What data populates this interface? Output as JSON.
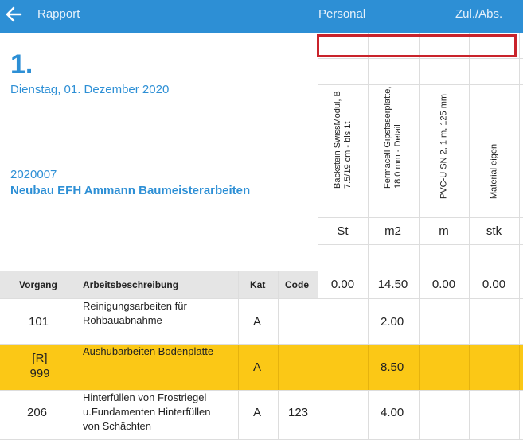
{
  "topbar": {
    "back_label": "Rapport",
    "personal_label": "Personal",
    "zul_label": "Zul./Abs."
  },
  "day": {
    "number": "1.",
    "date": "Dienstag, 01. Dezember 2020"
  },
  "project": {
    "number": "2020007",
    "name": "Neubau EFH Ammann Baumeisterarbeiten"
  },
  "materials": [
    {
      "name": "Backstein SwissModul, B 7.5/19 cm - bis 1t",
      "unit": "St",
      "total": "0.00"
    },
    {
      "name": "Fermacell Gipsfaserplatte, 18.0 mm - Detail",
      "unit": "m2",
      "total": "14.50"
    },
    {
      "name": "PVC-U SN 2, 1 m, 125 mm",
      "unit": "m",
      "total": "0.00"
    },
    {
      "name": "Material eigen",
      "unit": "stk",
      "total": "0.00"
    }
  ],
  "table": {
    "headers": {
      "vorgang": "Vorgang",
      "beschreibung": "Arbeitsbeschreibung",
      "kat": "Kat",
      "code": "Code"
    },
    "rows": [
      {
        "vorgang": "101",
        "beschreibung": "Reinigungsarbeiten für Rohbauabnahme",
        "kat": "A",
        "code": "",
        "qty": "2.00",
        "highlight": false
      },
      {
        "vorgang": "[R]\n999",
        "beschreibung": "Aushubarbeiten Bodenplatte",
        "kat": "A",
        "code": "",
        "qty": "8.50",
        "highlight": true
      },
      {
        "vorgang": "206",
        "beschreibung": "Hinterfüllen von Frostriegel u.Fundamenten Hinterfüllen von Schächten",
        "kat": "A",
        "code": "123",
        "qty": "4.00",
        "highlight": false
      }
    ]
  },
  "colors": {
    "accent": "#2d8fd5",
    "highlight": "#fbc816",
    "selection": "#c9232b"
  }
}
